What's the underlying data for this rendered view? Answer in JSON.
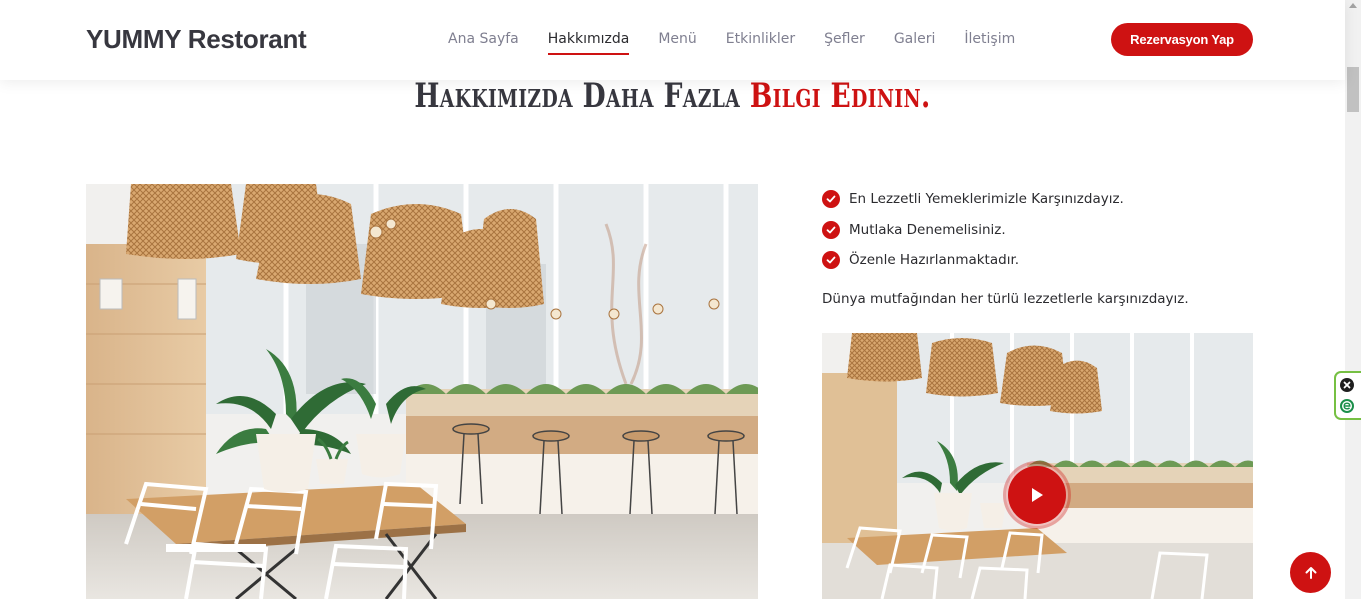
{
  "header": {
    "logo": "YUMMY Restorant",
    "nav": [
      {
        "label": "Ana Sayfa",
        "active": false
      },
      {
        "label": "Hakkımızda",
        "active": true
      },
      {
        "label": "Menü",
        "active": false
      },
      {
        "label": "Etkinlikler",
        "active": false
      },
      {
        "label": "Şefler",
        "active": false
      },
      {
        "label": "Galeri",
        "active": false
      },
      {
        "label": "İletişim",
        "active": false
      }
    ],
    "cta_label": "Rezervasyon Yap"
  },
  "about": {
    "title_main": "Hakkımızda Daha Fazla",
    "title_accent": "Bilgi Edinin.",
    "features": [
      "En Lezzetli Yemeklerimizle Karşınızdayız.",
      "Mutlaka Denemelisiniz.",
      "Özenle Hazırlanmaktadır."
    ],
    "description": "Dünya mutfağından her türlü lezzetlerle karşınızdayız."
  },
  "icons": {
    "check": "check-circle-icon",
    "play": "play-icon",
    "to_top": "arrow-up-icon"
  },
  "colors": {
    "accent": "#ce1212",
    "heading": "#37373f",
    "nav_inactive": "#7f7f90"
  }
}
